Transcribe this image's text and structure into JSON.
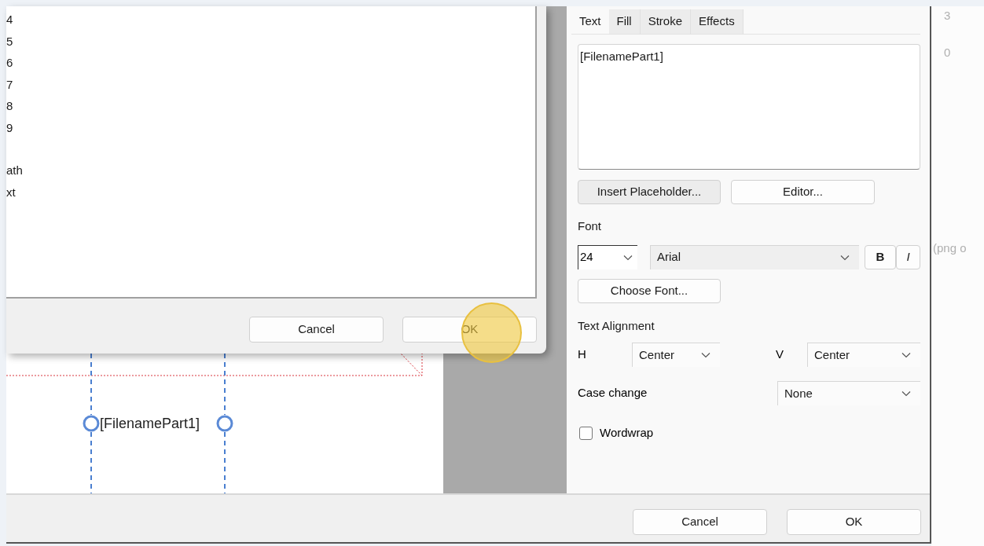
{
  "list_dialog": {
    "item_groups": [
      [
        "4",
        "5",
        "6",
        "7",
        "8",
        "9"
      ],
      [
        "ath",
        "xt"
      ]
    ],
    "buttons": [
      "Cancel",
      "OK"
    ]
  },
  "canvas": {
    "text": "[FilenamePart1]"
  },
  "properties": {
    "tabs": [
      {
        "label": "Text",
        "selected": true
      },
      {
        "label": "Fill",
        "selected": false
      },
      {
        "label": "Stroke",
        "selected": false
      },
      {
        "label": "Effects",
        "selected": false
      }
    ],
    "text_value": "[FilenamePart1]",
    "text_buttons": [
      "Insert Placeholder...",
      "Editor..."
    ],
    "font_label": "Font",
    "font_size": "24",
    "font_family": "Arial",
    "bold_label": "B",
    "italic_label": "I",
    "choose_font": "Choose Font...",
    "alignment_label": "Text Alignment",
    "h_label": "H",
    "h_value": "Center",
    "v_label": "V",
    "v_value": "Center",
    "case_label": "Case change",
    "case_value": "None",
    "wordwrap": {
      "label": "Wordwrap",
      "checked": false
    }
  },
  "footer_buttons": [
    "Cancel",
    "OK"
  ],
  "background_app": {
    "texts": [
      "3",
      "0",
      "(png o"
    ]
  }
}
